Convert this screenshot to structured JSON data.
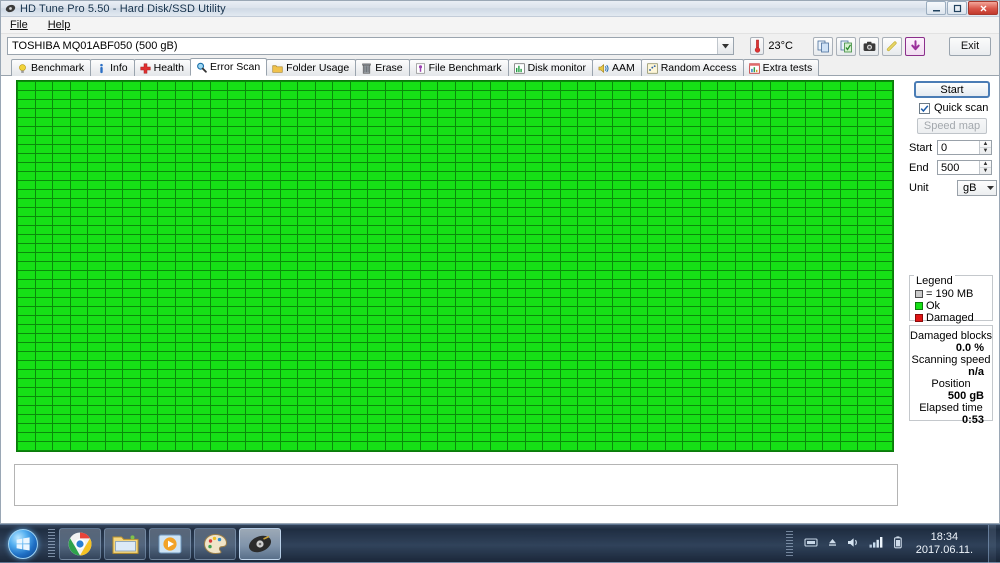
{
  "window": {
    "title": "HD Tune Pro 5.50 - Hard Disk/SSD Utility",
    "icon": "hdtune-icon",
    "controls": {
      "minimize": "minimize-icon",
      "maximize": "maximize-icon",
      "close": "close-icon"
    }
  },
  "menu": {
    "items": [
      {
        "label": "File",
        "accel": "F"
      },
      {
        "label": "Help",
        "accel": "H"
      }
    ]
  },
  "toolbar": {
    "drive": "TOSHIBA MQ01ABF050 (500 gB)",
    "temperature": "23°C",
    "thermometer_icon": "thermometer-icon",
    "dropdown_icon": "chevron-down-icon",
    "buttons": [
      {
        "name": "copy-button",
        "icon": "copy-icon"
      },
      {
        "name": "copy-to-clipboard-button",
        "icon": "copy-green-icon"
      },
      {
        "name": "screenshot-button",
        "icon": "camera-icon"
      },
      {
        "name": "attach-button",
        "icon": "paperclip-icon"
      },
      {
        "name": "save-button",
        "icon": "download-arrow-icon"
      }
    ],
    "exit_label": "Exit"
  },
  "tabs": [
    {
      "label": "Benchmark",
      "icon": "lightbulb-icon",
      "active": false
    },
    {
      "label": "Info",
      "icon": "info-icon",
      "active": false
    },
    {
      "label": "Health",
      "icon": "red-cross-icon",
      "active": false
    },
    {
      "label": "Error Scan",
      "icon": "magnifier-icon",
      "active": true
    },
    {
      "label": "Folder Usage",
      "icon": "folder-icon",
      "active": false
    },
    {
      "label": "Erase",
      "icon": "trash-icon",
      "active": false
    },
    {
      "label": "File Benchmark",
      "icon": "file-benchmark-icon",
      "active": false
    },
    {
      "label": "Disk monitor",
      "icon": "bar-chart-icon",
      "active": false
    },
    {
      "label": "AAM",
      "icon": "speaker-icon",
      "active": false
    },
    {
      "label": "Random Access",
      "icon": "scatter-icon",
      "active": false
    },
    {
      "label": "Extra tests",
      "icon": "window-chart-icon",
      "active": false
    }
  ],
  "scan": {
    "columns": 50,
    "rows": 46,
    "block_state": "ok",
    "colors": {
      "ok": "#16e016",
      "damaged": "#e01616",
      "grid": "#0a8a0a"
    }
  },
  "log": {
    "text": ""
  },
  "sidebar": {
    "start_button": "Start",
    "quick_scan": {
      "label": "Quick scan",
      "checked": true,
      "icon": "checkmark-icon"
    },
    "speed_map_button": {
      "label": "Speed map",
      "disabled": true
    },
    "start_field": {
      "label": "Start",
      "value": "0"
    },
    "end_field": {
      "label": "End",
      "value": "500"
    },
    "unit_field": {
      "label": "Unit",
      "value": "gB",
      "icon": "chevron-down-icon"
    },
    "legend": {
      "title": "Legend",
      "block_size": "= 190 MB",
      "ok_label": "Ok",
      "damaged_label": "Damaged"
    },
    "stats": [
      {
        "label": "Damaged blocks",
        "value": "0.0 %"
      },
      {
        "label": "Scanning speed",
        "value": "n/a"
      },
      {
        "label": "Position",
        "value": "500 gB"
      },
      {
        "label": "Elapsed time",
        "value": "0:53"
      }
    ]
  },
  "taskbar": {
    "start_icon": "windows-start-orb",
    "apps": [
      {
        "name": "taskbar-chrome",
        "icon": "chrome-icon",
        "active": false
      },
      {
        "name": "taskbar-explorer",
        "icon": "folder-explorer-icon",
        "active": false
      },
      {
        "name": "taskbar-media-player",
        "icon": "media-player-icon",
        "active": false
      },
      {
        "name": "taskbar-paint",
        "icon": "paint-palette-icon",
        "active": false
      },
      {
        "name": "taskbar-hdtune",
        "icon": "hard-disk-icon",
        "active": true
      }
    ],
    "tray": [
      {
        "name": "tray-hidden-icons",
        "icon": "hidden-icons-icon"
      },
      {
        "name": "tray-safely-remove",
        "icon": "eject-icon"
      },
      {
        "name": "tray-volume",
        "icon": "speaker-icon"
      },
      {
        "name": "tray-network",
        "icon": "network-bars-icon"
      },
      {
        "name": "tray-battery",
        "icon": "battery-icon"
      }
    ],
    "clock": {
      "time": "18:34",
      "date": "2017.06.11."
    }
  }
}
